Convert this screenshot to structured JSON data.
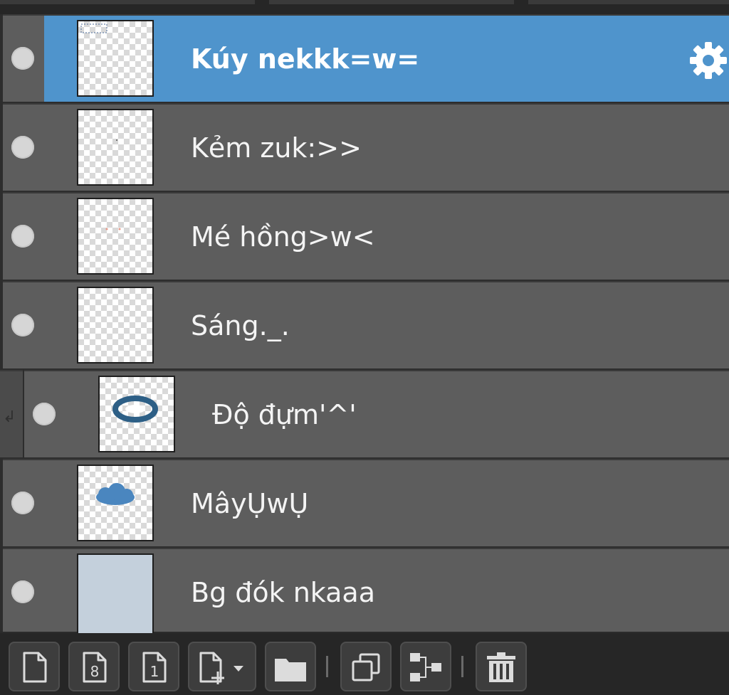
{
  "layers": [
    {
      "name": "Kúy nekkk=w=",
      "selected": true,
      "thumb": "sketch"
    },
    {
      "name": "Kẻm zuk:>>",
      "selected": false,
      "thumb": "transparent"
    },
    {
      "name": "Mé hồng>w<",
      "selected": false,
      "thumb": "transparent-pink-dots"
    },
    {
      "name": "Sáng._.",
      "selected": false,
      "thumb": "transparent"
    },
    {
      "name": "Độ đựm'^'",
      "selected": false,
      "thumb": "blue-ring",
      "clipping": true
    },
    {
      "name": "MâyỤwỤ",
      "selected": false,
      "thumb": "blue-cloud"
    },
    {
      "name": "Bg đók nkaaa",
      "selected": false,
      "thumb": "solid",
      "fill": "#c4d0dc"
    }
  ],
  "icons": {
    "visibility": "eye-visible-icon",
    "settings": "gear-icon",
    "clipping": "clip-arrow-icon"
  },
  "toolbar": {
    "buttons": [
      "new-layer-icon",
      "new-8bit-layer-icon",
      "new-1bit-layer-icon",
      "add-layer-dropdown-icon",
      "new-folder-icon",
      "duplicate-layer-icon",
      "merge-down-icon",
      "delete-layer-icon"
    ],
    "bit8_label": "8",
    "bit1_label": "1"
  },
  "colors": {
    "selected": "#4f94cc",
    "row": "#5d5d5d",
    "divider": "#3a3a3a",
    "toolbar": "#262626",
    "cloud": "#4a86bf",
    "ring": "#2d5f86"
  }
}
